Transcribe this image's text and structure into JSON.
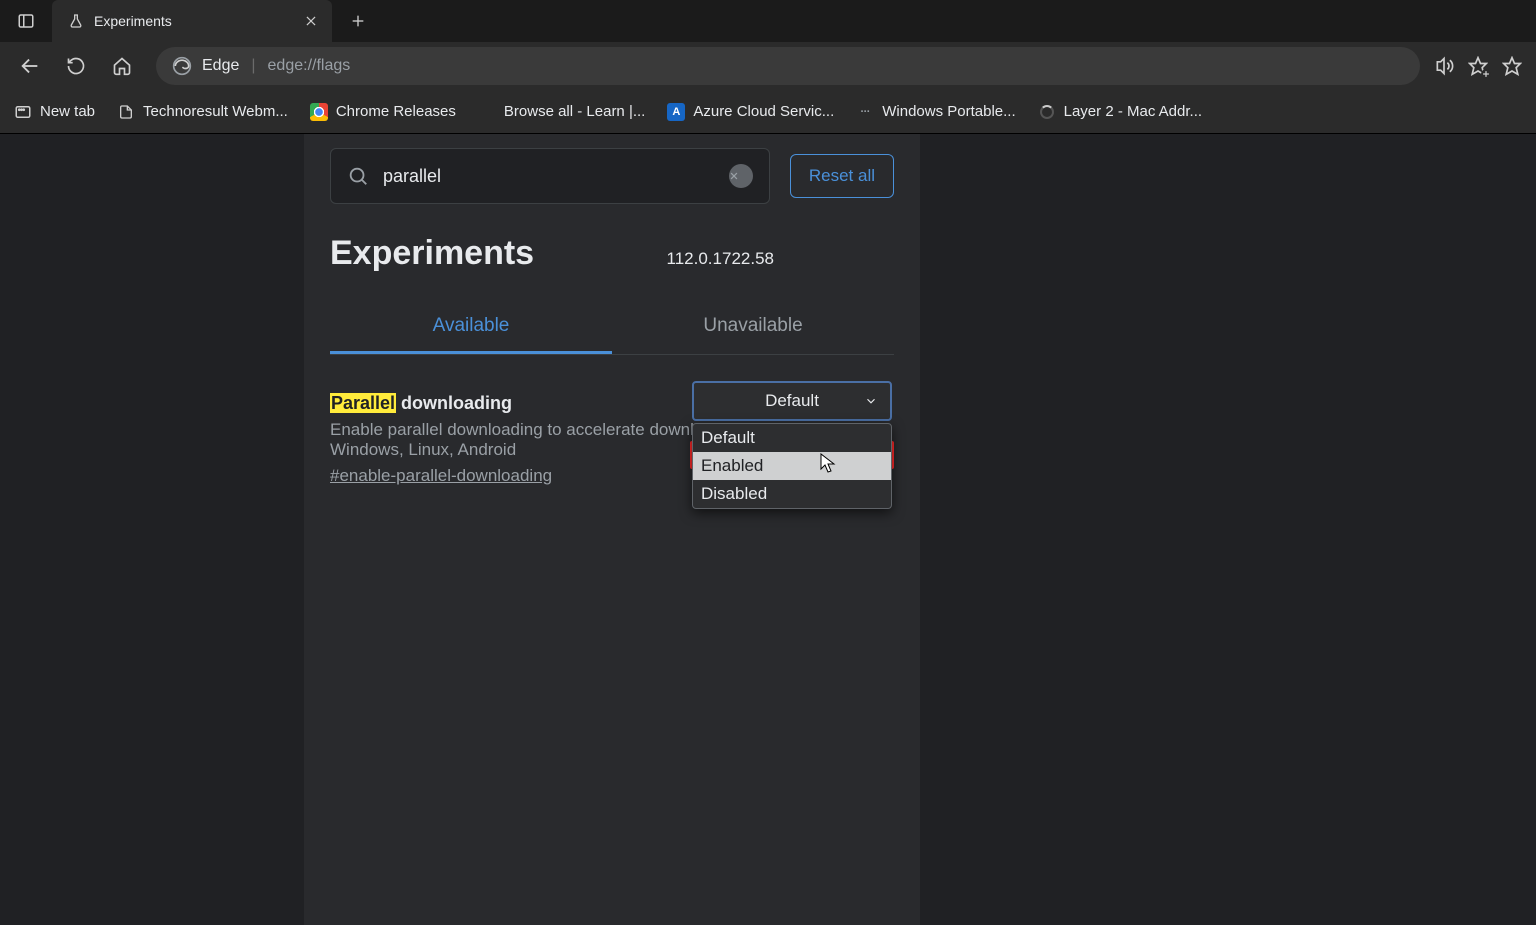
{
  "tab": {
    "title": "Experiments"
  },
  "address": {
    "prefix": "Edge",
    "url": "edge://flags"
  },
  "bookmarks": [
    {
      "label": "New tab"
    },
    {
      "label": "Technoresult Webm..."
    },
    {
      "label": "Chrome Releases"
    },
    {
      "label": "Browse all - Learn |..."
    },
    {
      "label": "Azure Cloud Servic..."
    },
    {
      "label": "Windows Portable..."
    },
    {
      "label": "Layer 2 - Mac Addr..."
    }
  ],
  "search": {
    "value": "parallel"
  },
  "reset_label": "Reset all",
  "page_title": "Experiments",
  "version": "112.0.1722.58",
  "tabs": {
    "available": "Available",
    "unavailable": "Unavailable"
  },
  "flag": {
    "highlight": "Parallel",
    "rest": " downloading",
    "desc": "Enable parallel downloading to accelerate download speed. – Mac, Windows, Linux, Android",
    "hash": "#enable-parallel-downloading",
    "selected": "Default",
    "options": [
      "Default",
      "Enabled",
      "Disabled"
    ]
  }
}
